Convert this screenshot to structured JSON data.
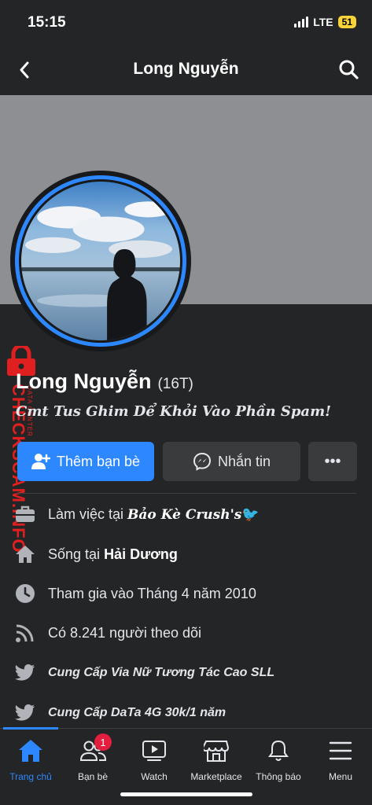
{
  "status": {
    "time": "15:15",
    "network": "LTE",
    "battery": "51"
  },
  "nav": {
    "title": "Long Nguyễn",
    "back_icon": "chevron-left-icon",
    "search_icon": "search-icon"
  },
  "profile": {
    "name": "Long Nguyễn",
    "nickname": "(16T)",
    "bio": "Cmt Tus Ghim Dể Khỏi Vào Phần Spam!"
  },
  "watermark": {
    "text": "CHECKSCAM.INFO",
    "subtext": "DATA CENTER"
  },
  "actions": {
    "add_friend": "Thêm bạn bè",
    "message": "Nhắn tin",
    "more": "•••"
  },
  "details": [
    {
      "icon": "briefcase-icon",
      "prefix": "Làm việc tại ",
      "value": "Bảo Kè Crush's",
      "suffix": "🐦"
    },
    {
      "icon": "home-icon",
      "prefix": "Sống tại ",
      "value": "Hải Dương",
      "suffix": ""
    },
    {
      "icon": "clock-icon",
      "prefix": "Tham gia vào Tháng 4 năm 2010",
      "value": "",
      "suffix": ""
    },
    {
      "icon": "rss-icon",
      "prefix": "Có 8.241 người theo dõi",
      "value": "",
      "suffix": ""
    },
    {
      "icon": "twitter-icon",
      "prefix": "Cung Cấp Via Nữ Tương Tác Cao SLL",
      "value": "",
      "suffix": ""
    },
    {
      "icon": "twitter-icon",
      "prefix": "Cung Cấp DaTa 4G 30k/1 năm",
      "value": "",
      "suffix": ""
    }
  ],
  "tabs": [
    {
      "label": "Trang chủ",
      "icon": "home-tab-icon",
      "active": true
    },
    {
      "label": "Bạn bè",
      "icon": "friends-icon",
      "badge": "1"
    },
    {
      "label": "Watch",
      "icon": "watch-icon"
    },
    {
      "label": "Marketplace",
      "icon": "marketplace-icon"
    },
    {
      "label": "Thông báo",
      "icon": "bell-icon"
    },
    {
      "label": "Menu",
      "icon": "menu-icon"
    }
  ],
  "colors": {
    "accent": "#2d88ff",
    "background": "#242526",
    "badge": "#e41e3f",
    "watermark": "#e02020"
  }
}
